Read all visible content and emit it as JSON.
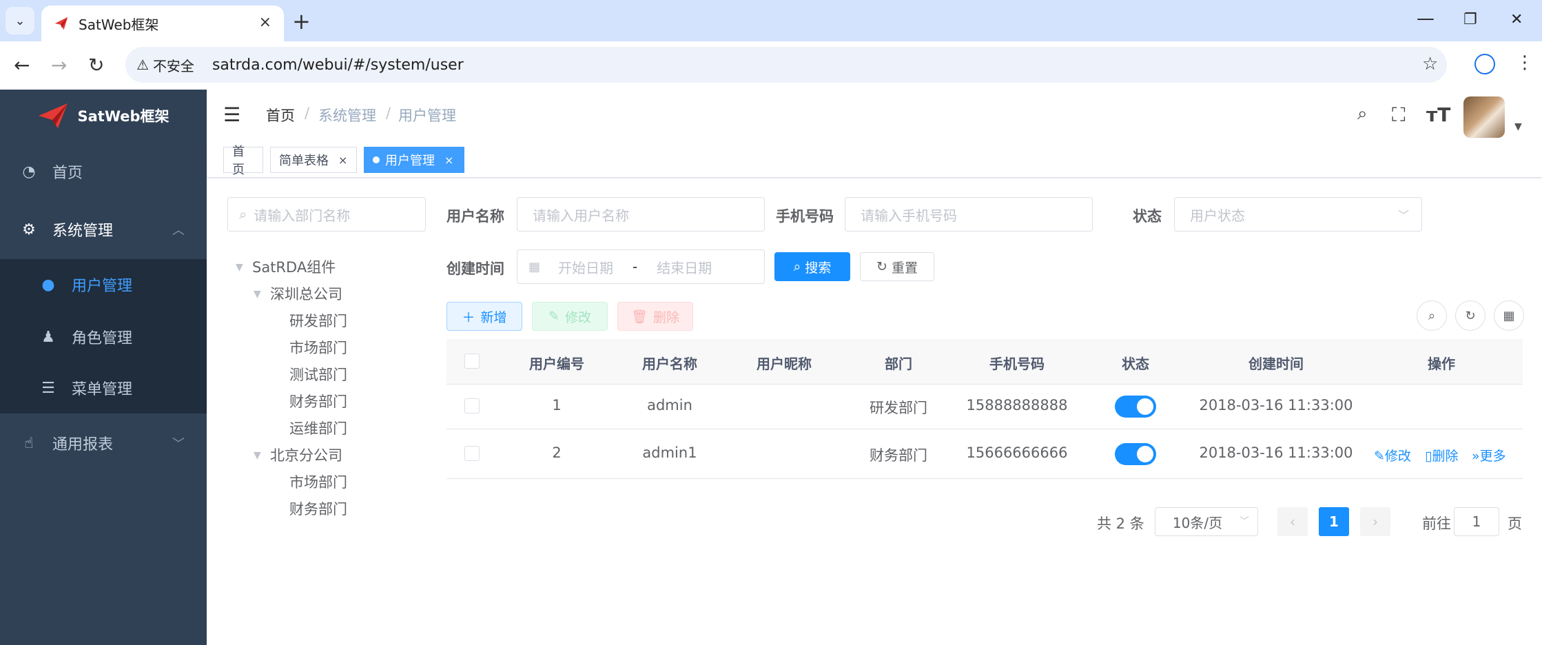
{
  "browser": {
    "tab_title": "SatWeb框架",
    "tab_close": "×",
    "new_tab": "+",
    "security_warning": "不安全",
    "url": "satrda.com/webui/#/system/user",
    "minimize": "—",
    "restore": "❐",
    "close": "✕"
  },
  "sidebar": {
    "logo_text": "SatWeb框架",
    "items": [
      {
        "label": "首页",
        "icon": "dashboard-icon"
      },
      {
        "label": "系统管理",
        "icon": "gear-icon"
      },
      {
        "label": "用户管理",
        "icon": "user-icon"
      },
      {
        "label": "角色管理",
        "icon": "peoples-icon"
      },
      {
        "label": "菜单管理",
        "icon": "tree-table-icon"
      },
      {
        "label": "通用报表",
        "icon": "hand-icon"
      }
    ],
    "active_color": "#409eff",
    "bg_color": "#304156"
  },
  "header": {
    "breadcrumb": [
      "首页",
      "系统管理",
      "用户管理"
    ],
    "separator": "/"
  },
  "tags": [
    {
      "label": "首页"
    },
    {
      "label": "简单表格",
      "close": "×"
    },
    {
      "label": "用户管理",
      "close": "×",
      "active": true
    }
  ],
  "dept_tree": {
    "search_placeholder": "请输入部门名称",
    "nodes": {
      "root": "SatRDA组件",
      "sz": "深圳总公司",
      "sz_children": [
        "研发部门",
        "市场部门",
        "测试部门",
        "财务部门",
        "运维部门"
      ],
      "bj": "北京分公司",
      "bj_children": [
        "市场部门",
        "财务部门"
      ]
    }
  },
  "search_form": {
    "username_label": "用户名称",
    "username_placeholder": "请输入用户名称",
    "phone_label": "手机号码",
    "phone_placeholder": "请输入手机号码",
    "status_label": "状态",
    "status_placeholder": "用户状态",
    "time_label": "创建时间",
    "start_placeholder": "开始日期",
    "range_sep": "-",
    "end_placeholder": "结束日期",
    "search_button": "搜索",
    "reset_button": "重置"
  },
  "toolbar": {
    "add": "新增",
    "edit": "修改",
    "delete": "删除"
  },
  "table": {
    "columns": [
      "用户编号",
      "用户名称",
      "用户昵称",
      "部门",
      "手机号码",
      "状态",
      "创建时间",
      "操作"
    ],
    "rows": [
      {
        "id": "1",
        "username": "admin",
        "nickname": "",
        "dept": "研发部门",
        "phone": "15888888888",
        "status": true,
        "created": "2018-03-16 11:33:00"
      },
      {
        "id": "2",
        "username": "admin1",
        "nickname": "",
        "dept": "财务部门",
        "phone": "15666666666",
        "status": true,
        "created": "2018-03-16 11:33:00",
        "ops": [
          "修改",
          "删除",
          "更多"
        ]
      }
    ]
  },
  "pagination": {
    "total_text": "共 2 条",
    "page_size": "10条/页",
    "current_page": "1",
    "goto_label": "前往",
    "goto_value": "1",
    "page_suffix": "页"
  }
}
